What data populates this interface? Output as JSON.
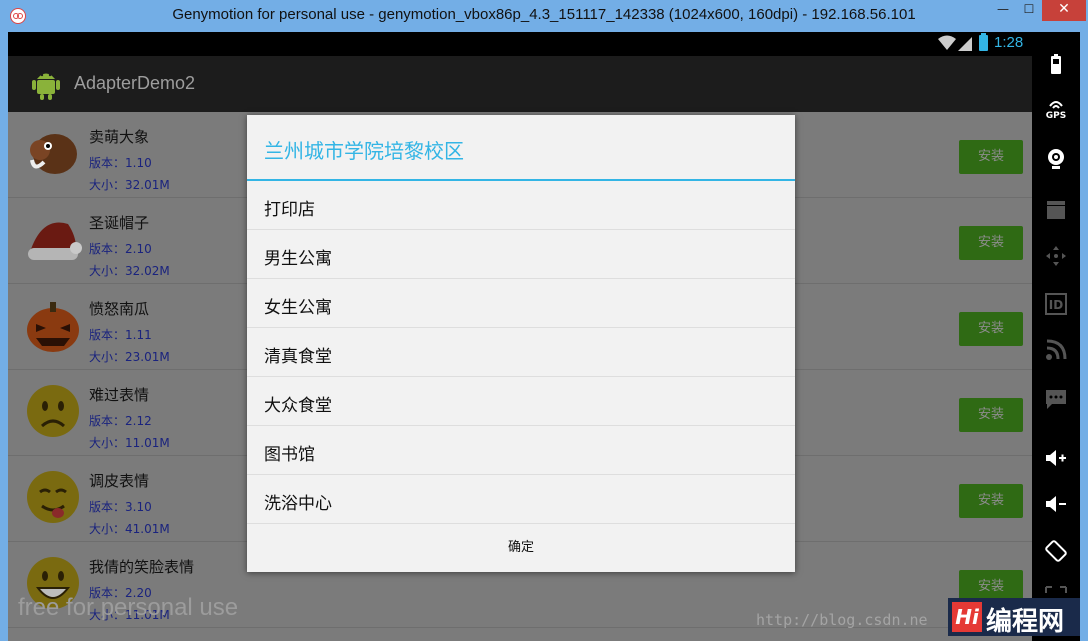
{
  "window": {
    "title": "Genymotion for personal use - genymotion_vbox86p_4.3_151117_142338 (1024x600, 160dpi) - 192.168.56.101",
    "minimize": "—",
    "maximize": "☐",
    "close": "✕"
  },
  "statusbar": {
    "time": "1:28"
  },
  "actionbar": {
    "title": "AdapterDemo2"
  },
  "list": {
    "items": [
      {
        "name": "卖萌大象",
        "version": "版本：1.10",
        "size": "大小：32.01M",
        "button": "安装",
        "icon": "elephant-icon"
      },
      {
        "name": "圣诞帽子",
        "version": "版本：2.10",
        "size": "大小：32.02M",
        "button": "安装",
        "icon": "santa-hat-icon"
      },
      {
        "name": "愤怒南瓜",
        "version": "版本：1.11",
        "size": "大小：23.01M",
        "button": "安装",
        "icon": "pumpkin-icon"
      },
      {
        "name": "难过表情",
        "version": "版本：2.12",
        "size": "大小：11.01M",
        "button": "安装",
        "icon": "sad-face-icon"
      },
      {
        "name": "调皮表情",
        "version": "版本：3.10",
        "size": "大小：41.01M",
        "button": "安装",
        "icon": "tongue-face-icon"
      },
      {
        "name": "我倩的笑脸表情",
        "version": "版本：2.20",
        "size": "大小：11.01M",
        "button": "安装",
        "icon": "grin-face-icon"
      }
    ]
  },
  "dialog": {
    "title": "兰州城市学院培黎校区",
    "items": [
      "打印店",
      "男生公寓",
      "女生公寓",
      "清真食堂",
      "大众食堂",
      "图书馆",
      "洗浴中心"
    ],
    "ok": "确定"
  },
  "toolbar": {
    "gps_label": "GPS",
    "id_label": "ID"
  },
  "watermarks": {
    "personal": "free for personal use",
    "csdn": "http://blog.csdn.ne",
    "logo_mark": "Hi",
    "logo_text": "编程网"
  },
  "colors": {
    "accent": "#33b5e5",
    "install": "#2f6a14",
    "titlebar": "#73aee6"
  }
}
